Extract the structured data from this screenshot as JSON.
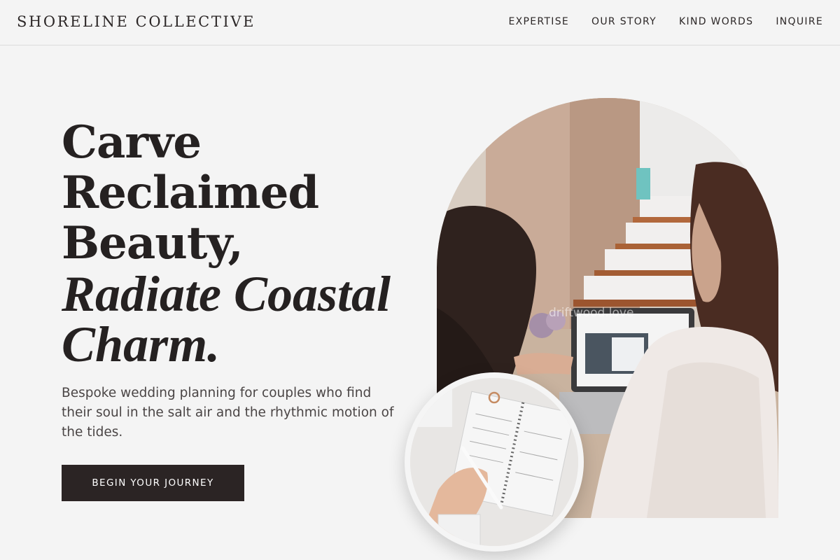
{
  "header": {
    "brand": "SHORELINE COLLECTIVE",
    "nav": [
      "EXPERTISE",
      "OUR STORY",
      "KIND WORDS",
      "INQUIRE"
    ]
  },
  "hero": {
    "headline_lines": [
      "Carve",
      "Reclaimed",
      "Beauty,"
    ],
    "headline_italic_lines": [
      "Radiate Coastal",
      "Charm."
    ],
    "lede": "Bespoke wedding planning for couples who find their soul in the salt air and the rhythmic motion of the tides.",
    "cta_label": "BEGIN YOUR JOURNEY"
  },
  "images": {
    "arch_photo": "photo-two-women-reviewing-wedding-photos-on-laptop",
    "arch_watermark": "driftwood.love",
    "circle_photo": "photo-hand-writing-in-planner-notebook"
  },
  "colors": {
    "background": "#f4f4f4",
    "text": "#2a2525",
    "button_bg": "#2b2424",
    "button_text": "#ffffff"
  }
}
